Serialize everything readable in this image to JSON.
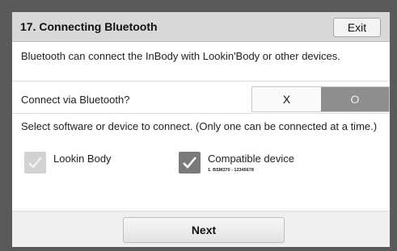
{
  "header": {
    "title": "17. Connecting Bluetooth",
    "exit_label": "Exit"
  },
  "description": "Bluetooth can connect the InBody with Lookin'Body or other devices.",
  "bluetooth_toggle": {
    "label": "Connect via Bluetooth?",
    "off_label": "X",
    "on_label": "O",
    "selected": "O"
  },
  "select_prompt": "Select software or device to connect. (Only one can be connected at a time.)",
  "options": [
    {
      "label": "Lookin Body",
      "checked": false,
      "detail": ""
    },
    {
      "label": "Compatible device",
      "checked": true,
      "detail": "1. BSM370 - 12345678"
    }
  ],
  "footer": {
    "next_label": "Next"
  },
  "colors": {
    "header_bg": "#d8d8d8",
    "toggle_selected": "#8e8e8e",
    "checkbox_checked": "#7a7a7a",
    "checkbox_unchecked": "#d2d2d2"
  }
}
